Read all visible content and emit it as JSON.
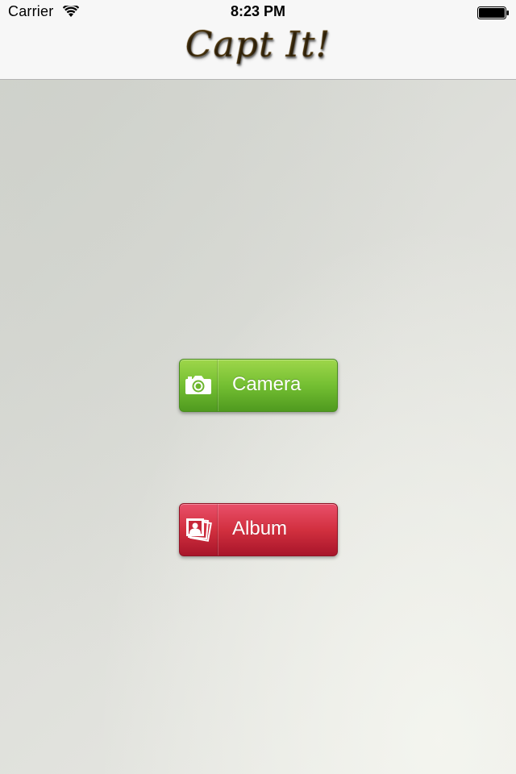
{
  "status_bar": {
    "carrier": "Carrier",
    "time": "8:23 PM",
    "wifi_icon": "wifi-icon",
    "battery_icon": "battery-icon"
  },
  "nav_bar": {
    "logo_text": "Capt It!"
  },
  "buttons": {
    "camera": {
      "label": "Camera",
      "icon": "camera-icon",
      "color": "#74bf32"
    },
    "album": {
      "label": "Album",
      "icon": "photo-album-icon",
      "color": "#d2303f"
    }
  }
}
